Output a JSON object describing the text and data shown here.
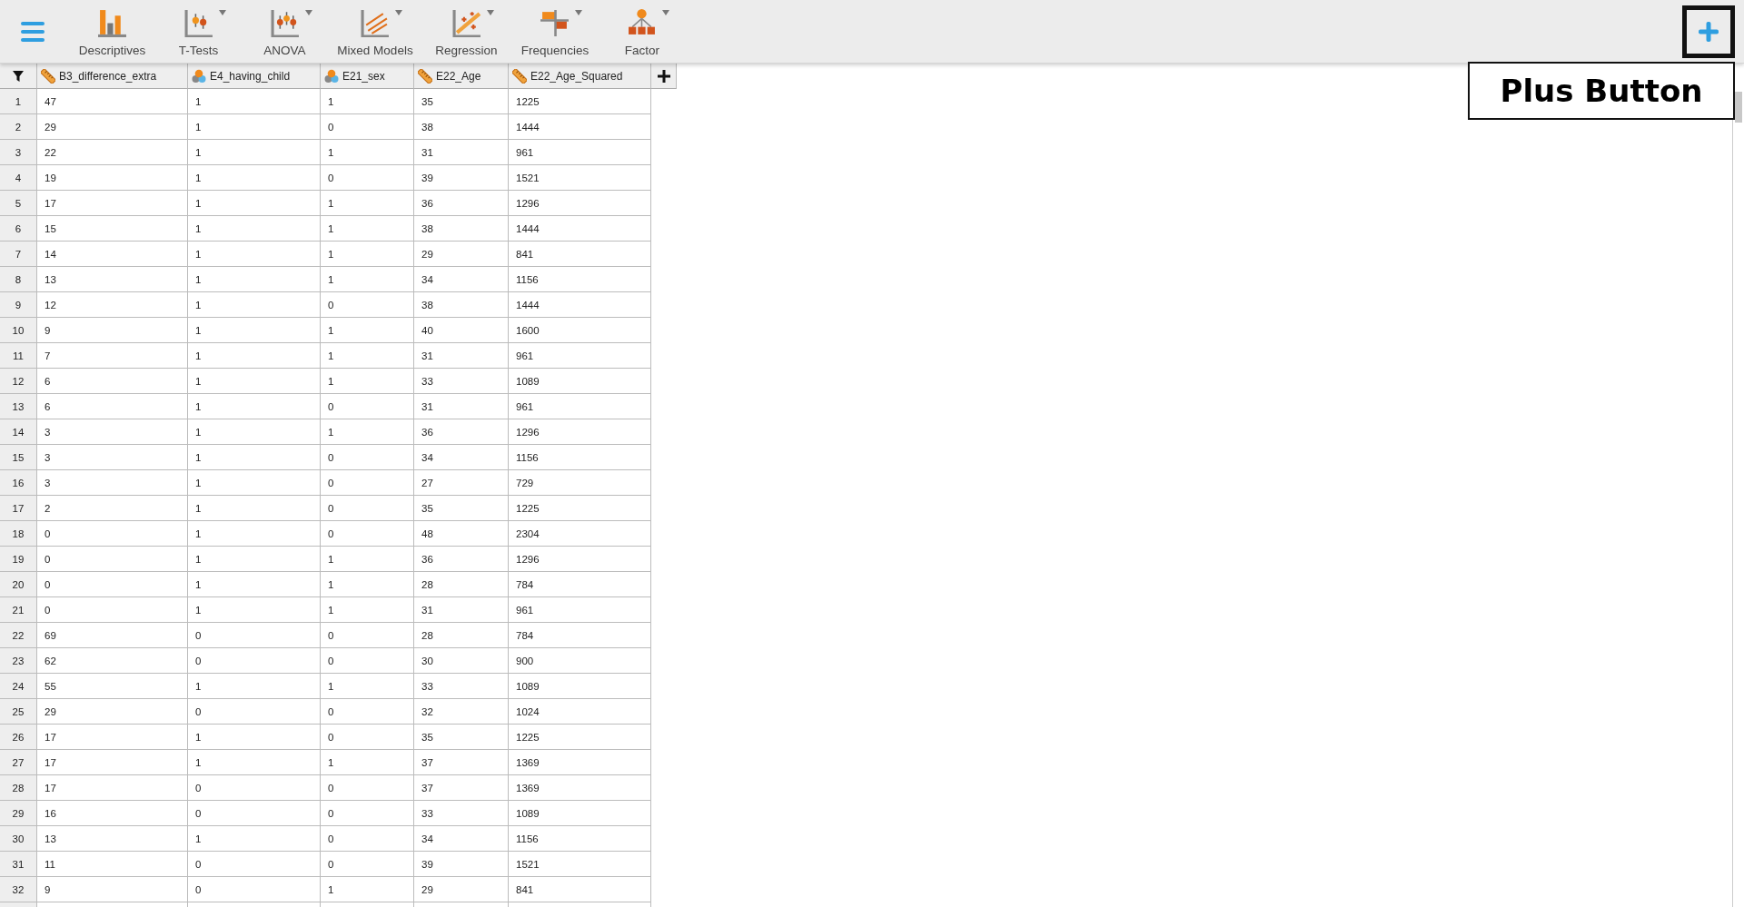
{
  "toolbar": {
    "items": [
      {
        "label": "Descriptives",
        "has_menu": false
      },
      {
        "label": "T-Tests",
        "has_menu": true
      },
      {
        "label": "ANOVA",
        "has_menu": true
      },
      {
        "label": "Mixed Models",
        "has_menu": true
      },
      {
        "label": "Regression",
        "has_menu": true
      },
      {
        "label": "Frequencies",
        "has_menu": true
      },
      {
        "label": "Factor",
        "has_menu": true
      }
    ]
  },
  "annotation": {
    "label": "Plus Button"
  },
  "table": {
    "columns": [
      {
        "name": "B3_difference_extra",
        "kind": "scale"
      },
      {
        "name": "E4_having_child",
        "kind": "nominal"
      },
      {
        "name": "E21_sex",
        "kind": "nominal"
      },
      {
        "name": "E22_Age",
        "kind": "scale"
      },
      {
        "name": "E22_Age_Squared",
        "kind": "scale"
      }
    ],
    "rows": [
      [
        "1",
        "47",
        "1",
        "1",
        "35",
        "1225"
      ],
      [
        "2",
        "29",
        "1",
        "0",
        "38",
        "1444"
      ],
      [
        "3",
        "22",
        "1",
        "1",
        "31",
        "961"
      ],
      [
        "4",
        "19",
        "1",
        "0",
        "39",
        "1521"
      ],
      [
        "5",
        "17",
        "1",
        "1",
        "36",
        "1296"
      ],
      [
        "6",
        "15",
        "1",
        "1",
        "38",
        "1444"
      ],
      [
        "7",
        "14",
        "1",
        "1",
        "29",
        "841"
      ],
      [
        "8",
        "13",
        "1",
        "1",
        "34",
        "1156"
      ],
      [
        "9",
        "12",
        "1",
        "0",
        "38",
        "1444"
      ],
      [
        "10",
        "9",
        "1",
        "1",
        "40",
        "1600"
      ],
      [
        "11",
        "7",
        "1",
        "1",
        "31",
        "961"
      ],
      [
        "12",
        "6",
        "1",
        "1",
        "33",
        "1089"
      ],
      [
        "13",
        "6",
        "1",
        "0",
        "31",
        "961"
      ],
      [
        "14",
        "3",
        "1",
        "1",
        "36",
        "1296"
      ],
      [
        "15",
        "3",
        "1",
        "0",
        "34",
        "1156"
      ],
      [
        "16",
        "3",
        "1",
        "0",
        "27",
        "729"
      ],
      [
        "17",
        "2",
        "1",
        "0",
        "35",
        "1225"
      ],
      [
        "18",
        "0",
        "1",
        "0",
        "48",
        "2304"
      ],
      [
        "19",
        "0",
        "1",
        "1",
        "36",
        "1296"
      ],
      [
        "20",
        "0",
        "1",
        "1",
        "28",
        "784"
      ],
      [
        "21",
        "0",
        "1",
        "1",
        "31",
        "961"
      ],
      [
        "22",
        "69",
        "0",
        "0",
        "28",
        "784"
      ],
      [
        "23",
        "62",
        "0",
        "0",
        "30",
        "900"
      ],
      [
        "24",
        "55",
        "1",
        "1",
        "33",
        "1089"
      ],
      [
        "25",
        "29",
        "0",
        "0",
        "32",
        "1024"
      ],
      [
        "26",
        "17",
        "1",
        "0",
        "35",
        "1225"
      ],
      [
        "27",
        "17",
        "1",
        "1",
        "37",
        "1369"
      ],
      [
        "28",
        "17",
        "0",
        "0",
        "37",
        "1369"
      ],
      [
        "29",
        "16",
        "0",
        "0",
        "33",
        "1089"
      ],
      [
        "30",
        "13",
        "1",
        "0",
        "34",
        "1156"
      ],
      [
        "31",
        "11",
        "0",
        "0",
        "39",
        "1521"
      ],
      [
        "32",
        "9",
        "0",
        "1",
        "29",
        "841"
      ]
    ]
  }
}
